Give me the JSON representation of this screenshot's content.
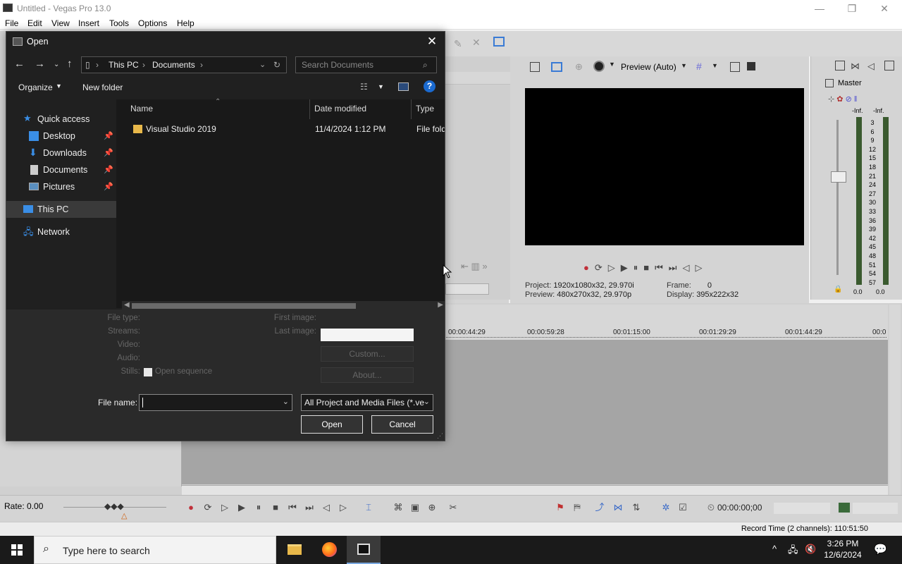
{
  "app": {
    "title": "Untitled - Vegas Pro 13.0",
    "menu": [
      "File",
      "Edit",
      "View",
      "Insert",
      "Tools",
      "Options",
      "Help"
    ]
  },
  "preview": {
    "mode": "Preview (Auto)",
    "project_label": "Project:",
    "project_value": "1920x1080x32, 29.970i",
    "preview_label": "Preview:",
    "preview_value": "480x270x32, 29.970p",
    "frame_label": "Frame:",
    "frame_value": "0",
    "display_label": "Display:",
    "display_value": "395x222x32"
  },
  "master": {
    "title": "Master",
    "left_inf": "-Inf.",
    "right_inf": "-Inf.",
    "scale": [
      "3",
      "6",
      "9",
      "12",
      "15",
      "18",
      "21",
      "24",
      "27",
      "30",
      "33",
      "36",
      "39",
      "42",
      "45",
      "48",
      "51",
      "54",
      "57"
    ],
    "left_bottom": "0.0",
    "right_bottom": "0.0"
  },
  "timeline": {
    "ticks": [
      "00:00:44:29",
      "00:00:59:28",
      "00:01:15:00",
      "00:01:29:29",
      "00:01:44:29",
      "00:0"
    ],
    "rate": "Rate: 0.00",
    "timecode": "00:00:00;00",
    "record_time": "Record Time (2 channels): 110:51:50"
  },
  "dialog": {
    "title": "Open",
    "breadcrumb": [
      "This PC",
      "Documents"
    ],
    "search_placeholder": "Search Documents",
    "organize": "Organize",
    "new_folder": "New folder",
    "nav": {
      "quick_access": "Quick access",
      "desktop": "Desktop",
      "downloads": "Downloads",
      "documents": "Documents",
      "pictures": "Pictures",
      "this_pc": "This PC",
      "network": "Network"
    },
    "columns": {
      "name": "Name",
      "date": "Date modified",
      "type": "Type"
    },
    "files": [
      {
        "name": "Visual Studio 2019",
        "date": "11/4/2024 1:12 PM",
        "type": "File fold"
      }
    ],
    "info": {
      "file_type": "File type:",
      "streams": "Streams:",
      "video": "Video:",
      "audio": "Audio:",
      "stills": "Stills:",
      "open_sequence": "Open sequence",
      "first_image": "First image:",
      "last_image": "Last image:",
      "custom": "Custom...",
      "about": "About..."
    },
    "file_name_label": "File name:",
    "file_name_value": "",
    "file_type_value": "All Project and Media Files (*.ve",
    "open_button": "Open",
    "cancel_button": "Cancel"
  },
  "taskbar": {
    "search_placeholder": "Type here to search",
    "time": "3:26 PM",
    "date": "12/6/2024"
  },
  "colors": {
    "dialog_bg": "#202020",
    "folder_yellow": "#e8b84a",
    "accent_blue": "#3a8ee6"
  }
}
